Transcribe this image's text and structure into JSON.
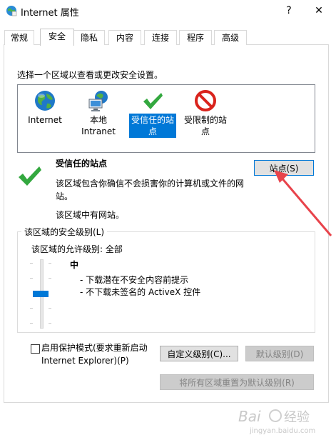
{
  "window": {
    "title": "Internet 属性",
    "help_glyph": "?",
    "close_glyph": "✕"
  },
  "tabs": [
    {
      "label": "常规",
      "active": false
    },
    {
      "label": "安全",
      "active": true
    },
    {
      "label": "隐私",
      "active": false
    },
    {
      "label": "内容",
      "active": false
    },
    {
      "label": "连接",
      "active": false
    },
    {
      "label": "程序",
      "active": false
    },
    {
      "label": "高级",
      "active": false
    }
  ],
  "security": {
    "zone_prompt": "选择一个区域以查看或更改安全设置。",
    "zones": [
      {
        "label": "Internet",
        "icon": "globe-icon"
      },
      {
        "label": "本地\nIntranet",
        "icon": "intranet-icon"
      },
      {
        "label": "受信任的站\n点",
        "icon": "check-icon",
        "selected": true
      },
      {
        "label": "受限制的站\n点",
        "icon": "restricted-icon"
      }
    ],
    "selected_zone_title": "受信任的站点",
    "selected_zone_desc": "该区域包含你确信不会损害你的计算机或文件的网站。",
    "selected_zone_note": "该区域中有网站。",
    "sites_button": "站点(S)",
    "level_group_title": "该区域的安全级别(L)",
    "allowed_level": "该区域的允许级别: 全部",
    "level_name": "中",
    "level_items": [
      "- 下载潜在不安全内容前提示",
      "- 不下载未签名的 ActiveX 控件"
    ],
    "slider_level": 0.5,
    "protected_mode_label_1": "启用保护模式(要求重新启动",
    "protected_mode_label_2": "Internet Explorer)(P)",
    "protected_mode_checked": false,
    "custom_level_button": "自定义级别(C)...",
    "default_level_button": "默认级别(D)",
    "reset_all_button": "将所有区域重置为默认级别(R)"
  },
  "colors": {
    "accent": "#0078d7",
    "check_green": "#33a83f",
    "restricted_red": "#d9231c",
    "annotation_arrow": "#e8434b"
  },
  "watermark": {
    "text": "Bai 经验",
    "subtext": "jingyan.baidu.com"
  }
}
